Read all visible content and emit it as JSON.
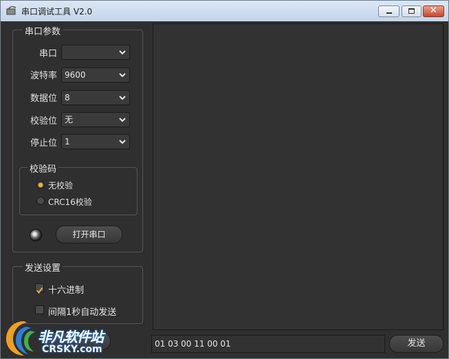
{
  "window": {
    "title": "串口调试工具 V2.0"
  },
  "serial_params": {
    "group_title": "串口参数",
    "port": {
      "label": "串口",
      "value": ""
    },
    "baud": {
      "label": "波特率",
      "value": "9600"
    },
    "databits": {
      "label": "数据位",
      "value": "8"
    },
    "parity": {
      "label": "校验位",
      "value": "无"
    },
    "stopbits": {
      "label": "停止位",
      "value": "1"
    },
    "checksum": {
      "group_title": "校验码",
      "options": [
        {
          "label": "无校验",
          "selected": true
        },
        {
          "label": "CRC16校验",
          "selected": false
        }
      ]
    },
    "open_button": "打开串口"
  },
  "send_settings": {
    "group_title": "发送设置",
    "hex": {
      "label": "十六进制",
      "checked": true
    },
    "auto_send": {
      "label": "间隔1秒自动发送",
      "checked": false
    }
  },
  "send": {
    "input_value": "01 03 00 11 00 01",
    "button": "发送"
  },
  "watermark": {
    "line1": "非凡软件站",
    "line2": "CRSKY.com"
  },
  "colors": {
    "accent": "#f0b030",
    "background": "#2f2f2f",
    "titlebar": "#c9d8e8"
  }
}
